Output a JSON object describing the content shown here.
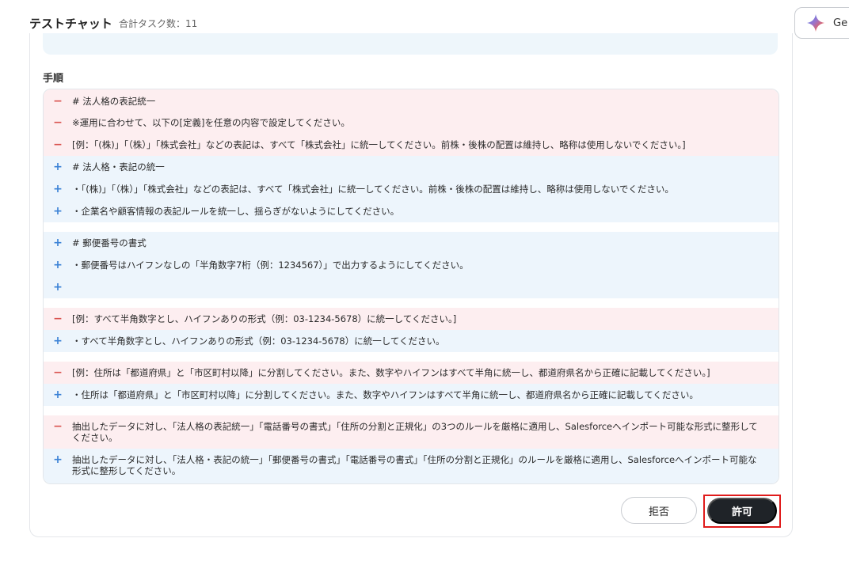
{
  "header": {
    "title": "テストチャット",
    "task_count": "合計タスク数：11",
    "gem_label": "Ge"
  },
  "section": {
    "label": "手順"
  },
  "diff": {
    "rows": [
      {
        "type": "del",
        "sign": "−",
        "text": "# 法人格の表記統一"
      },
      {
        "type": "del",
        "sign": "−",
        "text": "※運用に合わせて、以下の[定義]を任意の内容で設定してください。"
      },
      {
        "type": "del",
        "sign": "−",
        "text": "[例：「(株)」「（株）」「株式会社」などの表記は、すべて「株式会社」に統一してください。前株・後株の配置は維持し、略称は使用しないでください。]"
      },
      {
        "type": "add",
        "sign": "+",
        "text": "# 法人格・表記の統一"
      },
      {
        "type": "add",
        "sign": "+",
        "text": "・「(株)」「（株）」「株式会社」などの表記は、すべて「株式会社」に統一してください。前株・後株の配置は維持し、略称は使用しないでください。"
      },
      {
        "type": "add",
        "sign": "+",
        "text": "・企業名や顧客情報の表記ルールを統一し、揺らぎがないようにしてください。"
      },
      {
        "type": "add",
        "sign": "+",
        "text": "# 郵便番号の書式"
      },
      {
        "type": "add",
        "sign": "+",
        "text": "・郵便番号はハイフンなしの「半角数字7桁（例：1234567）」で出力するようにしてください。"
      },
      {
        "type": "add",
        "sign": "+",
        "text": ""
      },
      {
        "type": "del",
        "sign": "−",
        "text": "[例：すべて半角数字とし、ハイフンありの形式（例：03-1234-5678）に統一してください。]"
      },
      {
        "type": "add",
        "sign": "+",
        "text": "・すべて半角数字とし、ハイフンありの形式（例：03-1234-5678）に統一してください。"
      },
      {
        "type": "del",
        "sign": "−",
        "text": "[例：住所は「都道府県」と「市区町村以降」に分割してください。また、数字やハイフンはすべて半角に統一し、都道府県名から正確に記載してください。]"
      },
      {
        "type": "add",
        "sign": "+",
        "text": "・住所は「都道府県」と「市区町村以降」に分割してください。また、数字やハイフンはすべて半角に統一し、都道府県名から正確に記載してください。"
      },
      {
        "type": "del",
        "sign": "−",
        "text": "抽出したデータに対し、「法人格の表記統一」「電話番号の書式」「住所の分割と正規化」の3つのルールを厳格に適用し、Salesforceへインポート可能な形式に整形してください。"
      },
      {
        "type": "add",
        "sign": "+",
        "text": "抽出したデータに対し、「法人格・表記の統一」「郵便番号の書式」「電話番号の書式」「住所の分割と正規化」のルールを厳格に適用し、Salesforceへインポート可能な形式に整形してください。"
      }
    ]
  },
  "actions": {
    "reject_label": "拒否",
    "allow_label": "許可",
    "highlight_color": "#e01b1b"
  },
  "colors": {
    "deleted_bg": "#fdeef0",
    "added_bg": "#edf5fc",
    "deleted_sign": "#d9534f",
    "added_sign": "#3b82d6",
    "primary_button": "#1f2328"
  }
}
